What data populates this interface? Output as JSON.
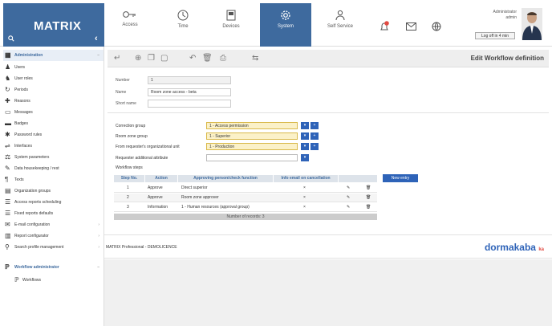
{
  "brand": {
    "name": "MATRIX",
    "search_icon": "search-icon"
  },
  "nav": [
    {
      "label": "Access",
      "icon": "key-icon"
    },
    {
      "label": "Time",
      "icon": "clock-icon"
    },
    {
      "label": "Devices",
      "icon": "device-icon"
    },
    {
      "label": "System",
      "icon": "gear-icon"
    },
    {
      "label": "Self Service",
      "icon": "person-icon"
    }
  ],
  "header": {
    "user_line1": "Administrator",
    "user_line2": "admin",
    "logout_label": "Log off in 4 min",
    "notification_badge_color": "#e24b43"
  },
  "sidebar": {
    "section_title": "Administration",
    "items": [
      {
        "label": "Users",
        "icon": "person-icon",
        "arrow": ""
      },
      {
        "label": "User roles",
        "icon": "people-icon",
        "arrow": ""
      },
      {
        "label": "Periods",
        "icon": "period-icon",
        "arrow": ""
      },
      {
        "label": "Reasons",
        "icon": "reason-icon",
        "arrow": ""
      },
      {
        "label": "Messages",
        "icon": "message-icon",
        "arrow": ""
      },
      {
        "label": "Badges",
        "icon": "badge-icon",
        "arrow": ""
      },
      {
        "label": "Password rules",
        "icon": "asterisk-icon",
        "arrow": ""
      },
      {
        "label": "Interfaces",
        "icon": "interface-icon",
        "arrow": ""
      },
      {
        "label": "System parameters",
        "icon": "parameters-icon",
        "arrow": ""
      },
      {
        "label": "Data housekeeping / rest",
        "icon": "brush-icon",
        "arrow": ""
      },
      {
        "label": "Texts",
        "icon": "text-icon",
        "arrow": ""
      },
      {
        "label": "Organization groups",
        "icon": "org-icon",
        "arrow": ""
      },
      {
        "label": "Access reports scheduling",
        "icon": "report-icon",
        "arrow": ""
      },
      {
        "label": "Fixed reports defaults",
        "icon": "report-icon",
        "arrow": ""
      },
      {
        "label": "E-mail configuration",
        "icon": "email-icon",
        "arrow": ">"
      },
      {
        "label": "Report configurator",
        "icon": "report-config-icon",
        "arrow": ">"
      },
      {
        "label": "Search profile management",
        "icon": "search-icon",
        "arrow": ">"
      }
    ],
    "workflow_section": "Workflow administrator",
    "workflow_item": "Workflows"
  },
  "toolbar": {
    "title": "Edit Workflow definition"
  },
  "form": {
    "number_label": "Number",
    "number_value": "1",
    "name_label": "Name",
    "name_value": "Room zone access - beta",
    "short_name_label": "Short name",
    "short_name_value": ""
  },
  "groups": {
    "correction_label": "Correction group",
    "correction_value": "1 - Access permission",
    "room_zone_label": "Room zone group",
    "room_zone_value": "1 - Superior",
    "org_unit_label": "From requester's organizational unit",
    "org_unit_value": "1 - Production",
    "attr_label": "Requester additional attribute",
    "attr_value": ""
  },
  "workflow_steps": {
    "title": "Workflow steps",
    "new_entry": "New entry",
    "columns": [
      "Step No.",
      "Action",
      "Approving person/check function",
      "Info email on cancellation"
    ],
    "rows": [
      {
        "step": "1",
        "action": "Approve",
        "function": "Direct superior",
        "email": "×"
      },
      {
        "step": "2",
        "action": "Approve",
        "function": "Room zone approver",
        "email": "×"
      },
      {
        "step": "3",
        "action": "Information",
        "function": "1 - Human resources (approval group)",
        "email": "×"
      }
    ],
    "records": "Number of records: 3"
  },
  "footer": {
    "product": "MATRIX Professional - DEMOLICENCE",
    "vendor": "dormakaba",
    "vendor_mark": "ka"
  }
}
